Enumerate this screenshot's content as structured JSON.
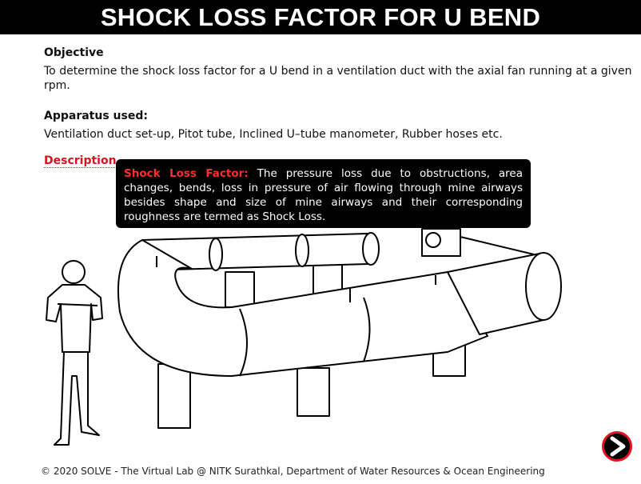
{
  "header": {
    "title": "SHOCK LOSS FACTOR FOR U BEND"
  },
  "objective": {
    "heading": "Objective",
    "text": "To determine the shock loss factor for a U bend in a ventilation duct with the axial fan running at a given rpm."
  },
  "apparatus": {
    "heading": "Apparatus used:",
    "text": "Ventilation duct set-up, Pitot tube, Inclined U–tube manometer, Rubber hoses etc."
  },
  "description": {
    "link_label": "Description",
    "tooltip_term": "Shock Loss Factor:",
    "tooltip_text": " The pressure loss due to obstructions, area changes, bends, loss in pressure of air flowing through mine airways besides shape and size of mine airways and their corresponding roughness are termed as Shock Loss."
  },
  "footer": {
    "text": "© 2020 SOLVE - The Virtual Lab @ NITK Surathkal, Department of Water Resources & Ocean Engineering"
  },
  "navigation": {
    "next_icon": "next-arrow-icon",
    "next_color": "#e0141e"
  },
  "colors": {
    "header_bg": "#000000",
    "accent_red": "#d4141e",
    "tooltip_bg": "#000000"
  }
}
